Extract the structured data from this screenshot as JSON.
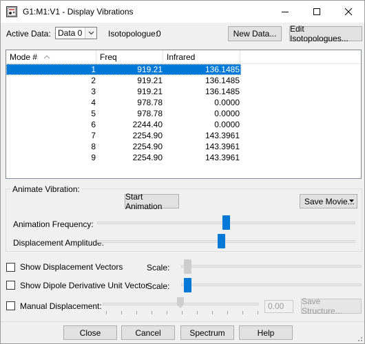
{
  "window": {
    "title": "G1:M1:V1 - Display Vibrations",
    "controls": {
      "minimize": "minimize-icon",
      "maximize": "maximize-icon",
      "close": "close-icon"
    }
  },
  "top_bar": {
    "active_data_label": "Active Data:",
    "active_data_value": "Data 0",
    "isotopologue_label": "Isotopologue:",
    "isotopologue_value": "0",
    "new_data_button": "New Data...",
    "edit_isotopologues_button": "Edit Isotopologues..."
  },
  "table": {
    "columns": [
      "Mode #",
      "Freq",
      "Infrared"
    ],
    "rows": [
      {
        "mode": "1",
        "freq": "919.21",
        "infrared": "136.1485",
        "selected": true
      },
      {
        "mode": "2",
        "freq": "919.21",
        "infrared": "136.1485"
      },
      {
        "mode": "3",
        "freq": "919.21",
        "infrared": "136.1485"
      },
      {
        "mode": "4",
        "freq": "978.78",
        "infrared": "0.0000"
      },
      {
        "mode": "5",
        "freq": "978.78",
        "infrared": "0.0000"
      },
      {
        "mode": "6",
        "freq": "2244.40",
        "infrared": "0.0000"
      },
      {
        "mode": "7",
        "freq": "2254.90",
        "infrared": "143.3961"
      },
      {
        "mode": "8",
        "freq": "2254.90",
        "infrared": "143.3961"
      },
      {
        "mode": "9",
        "freq": "2254.90",
        "infrared": "143.3961"
      }
    ]
  },
  "animate": {
    "group_label": "Animate Vibration:",
    "start_button": "Start Animation",
    "save_movie_button": "Save Movie...",
    "frequency_label": "Animation Frequency:",
    "frequency_level": 0.5,
    "amplitude_label": "Displacement Amplitude:",
    "amplitude_level": 0.48
  },
  "options": {
    "show_vectors_label": "Show Displacement Vectors",
    "show_vectors_checked": false,
    "vectors_scale_label": "Scale:",
    "show_dipole_label": "Show Dipole Derivative Unit Vector",
    "show_dipole_checked": false,
    "dipole_scale_label": "Scale:",
    "manual_label": "Manual Displacement:",
    "manual_checked": false,
    "manual_value": "0.00",
    "save_structure_button": "Save Structure..."
  },
  "footer": {
    "close_button": "Close",
    "cancel_button": "Cancel",
    "spectrum_button": "Spectrum",
    "help_button": "Help"
  },
  "colors": {
    "accent": "#0078d7",
    "background": "#f0f0f0"
  }
}
